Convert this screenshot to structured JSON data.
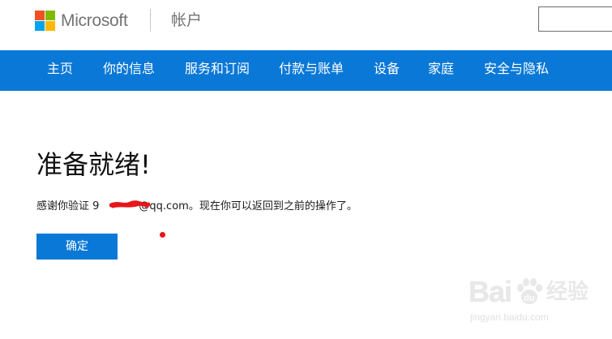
{
  "header": {
    "brand": "Microsoft",
    "section": "帐户",
    "search_value": "",
    "logo_colors": [
      "#f25022",
      "#7fba00",
      "#00a4ef",
      "#ffb900"
    ]
  },
  "nav": {
    "items": [
      {
        "label": "主页"
      },
      {
        "label": "你的信息"
      },
      {
        "label": "服务和订阅"
      },
      {
        "label": "付款与账单"
      },
      {
        "label": "设备"
      },
      {
        "label": "家庭"
      },
      {
        "label": "安全与隐私"
      }
    ]
  },
  "main": {
    "title": "准备就绪!",
    "message_prefix": "感谢你验证 ",
    "email_visible": "9",
    "email_domain": "@qq.com",
    "message_suffix": "。现在你可以返回到之前的操作了。",
    "confirm_label": "确定"
  },
  "watermark": {
    "main": "Bai",
    "brand_cn": "经验",
    "url": "jingyan.baidu.com"
  },
  "colors": {
    "accent": "#0a78d7",
    "redaction": "#e8151a"
  }
}
